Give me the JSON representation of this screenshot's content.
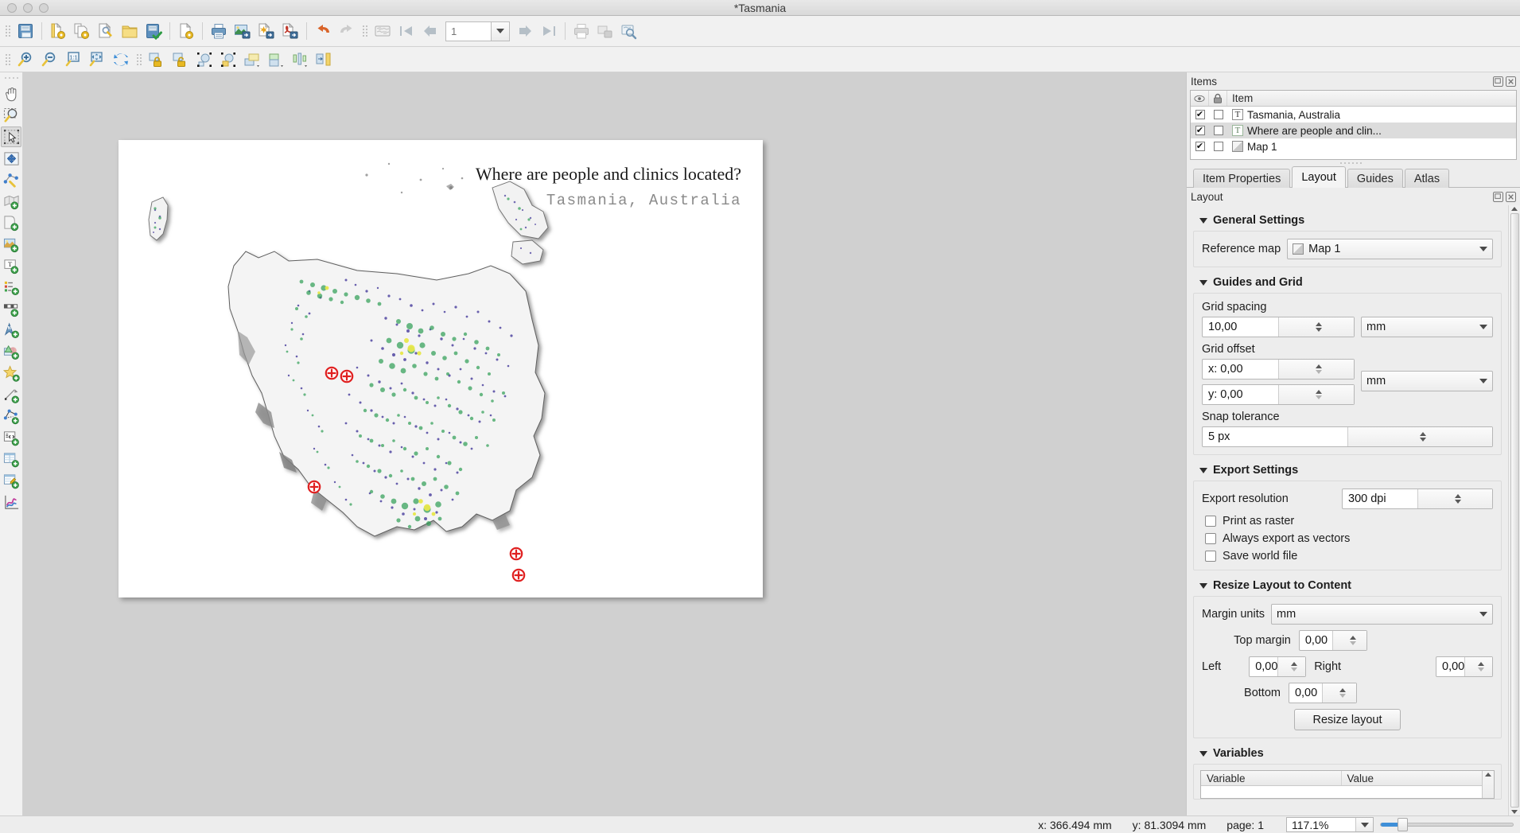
{
  "window": {
    "title": "*Tasmania"
  },
  "toolbar_main": {
    "buttons": [
      {
        "name": "save-project-icon",
        "tip": "Save Project"
      },
      {
        "name": "new-layout-icon",
        "tip": "New Layout"
      },
      {
        "name": "duplicate-layout-icon",
        "tip": "Duplicate Layout"
      },
      {
        "name": "layout-manager-icon",
        "tip": "Layout Manager"
      },
      {
        "name": "open-layout-folder-icon",
        "tip": "Layouts"
      },
      {
        "name": "save-as-template-icon",
        "tip": "Save as Template"
      },
      {
        "name": "add-pages-icon",
        "tip": "Add Pages"
      },
      {
        "name": "print-icon",
        "tip": "Print Layout"
      },
      {
        "name": "export-image-icon",
        "tip": "Export as Image"
      },
      {
        "name": "export-svg-icon",
        "tip": "Export as SVG"
      },
      {
        "name": "export-pdf-icon",
        "tip": "Export as PDF"
      },
      {
        "name": "undo-icon",
        "tip": "Undo"
      },
      {
        "name": "redo-icon",
        "tip": "Redo"
      },
      {
        "name": "revert-atlas-icon",
        "tip": "Preview Atlas"
      },
      {
        "name": "first-page-icon",
        "tip": "First Feature"
      },
      {
        "name": "previous-page-icon",
        "tip": "Previous Feature"
      },
      {
        "name": "next-page-icon",
        "tip": "Next Feature"
      },
      {
        "name": "last-page-icon",
        "tip": "Last Feature"
      },
      {
        "name": "print-atlas-icon",
        "tip": "Print Atlas"
      },
      {
        "name": "export-atlas-images-icon",
        "tip": "Export Atlas as Images"
      },
      {
        "name": "atlas-settings-icon",
        "tip": "Atlas Settings"
      }
    ],
    "page_value": "1",
    "page_placeholder": "1"
  },
  "toolbar_nav": {
    "buttons": [
      {
        "name": "zoom-in-icon",
        "tip": "Zoom In"
      },
      {
        "name": "zoom-out-icon",
        "tip": "Zoom Out"
      },
      {
        "name": "zoom-100-icon",
        "tip": "Zoom to 100%"
      },
      {
        "name": "zoom-full-icon",
        "tip": "Zoom Full"
      },
      {
        "name": "refresh-icon",
        "tip": "Refresh View"
      },
      {
        "name": "lock-items-icon",
        "tip": "Lock Selected Items"
      },
      {
        "name": "unlock-items-icon",
        "tip": "Unlock All Items"
      },
      {
        "name": "group-items-icon",
        "tip": "Group Items"
      },
      {
        "name": "ungroup-items-icon",
        "tip": "Ungroup Items"
      },
      {
        "name": "raise-items-icon",
        "tip": "Raise Selected Items"
      },
      {
        "name": "lower-items-icon",
        "tip": "Lower Selected Items"
      },
      {
        "name": "align-items-icon",
        "tip": "Align Selected Items"
      },
      {
        "name": "distribute-items-icon",
        "tip": "Distribute Items"
      }
    ]
  },
  "toolbar_tools": {
    "buttons": [
      {
        "name": "pan-layout-icon",
        "tip": "Pan Layout",
        "active": false
      },
      {
        "name": "zoom-tool-icon",
        "tip": "Zoom",
        "active": false
      },
      {
        "name": "select-move-item-icon",
        "tip": "Select/Move Item",
        "active": true
      },
      {
        "name": "move-item-content-icon",
        "tip": "Move Item Content",
        "active": false
      },
      {
        "name": "edit-nodes-icon",
        "tip": "Edit Nodes Item",
        "active": false
      },
      {
        "name": "add-map-icon",
        "tip": "Add Map",
        "active": false
      },
      {
        "name": "add-shape-icon",
        "tip": "Add Shape",
        "active": false
      },
      {
        "name": "add-picture-icon",
        "tip": "Add Picture",
        "active": false
      },
      {
        "name": "add-label-icon",
        "tip": "Add Label",
        "active": false
      },
      {
        "name": "add-legend-icon",
        "tip": "Add Legend",
        "active": false
      },
      {
        "name": "add-scalebar-icon",
        "tip": "Add Scale Bar",
        "active": false
      },
      {
        "name": "add-north-arrow-icon",
        "tip": "Add North Arrow",
        "active": false
      },
      {
        "name": "add-marker-icon",
        "tip": "Add Marker",
        "active": false
      },
      {
        "name": "add-node-shape-icon",
        "tip": "Add Node Item",
        "active": false
      },
      {
        "name": "add-arrow-icon",
        "tip": "Add Arrow",
        "active": false
      },
      {
        "name": "add-polyline-icon",
        "tip": "Add Polyline",
        "active": false
      },
      {
        "name": "add-html-icon",
        "tip": "Add HTML Frame",
        "active": false
      },
      {
        "name": "add-attribute-table-icon",
        "tip": "Add Attribute Table",
        "active": false
      },
      {
        "name": "add-fixed-table-icon",
        "tip": "Add Fixed Table",
        "active": false
      },
      {
        "name": "add-plot-icon",
        "tip": "Add Plot",
        "active": false
      }
    ]
  },
  "layout_page": {
    "title_main": "Where are people and clinics located?",
    "title_sub": "Tasmania, Australia"
  },
  "items_panel": {
    "header": "Items",
    "columns": {
      "visible": "eye-icon",
      "lock": "lock-icon",
      "item": "Item"
    },
    "rows": [
      {
        "label": "Tasmania, Australia",
        "visible": true,
        "locked": false,
        "type": "label",
        "selected": false
      },
      {
        "label": "Where are people and clin...",
        "visible": true,
        "locked": false,
        "type": "label",
        "selected": true
      },
      {
        "label": "Map 1",
        "visible": true,
        "locked": false,
        "type": "map",
        "selected": false
      }
    ]
  },
  "tabs": [
    {
      "label": "Item Properties",
      "selected": false
    },
    {
      "label": "Layout",
      "selected": true
    },
    {
      "label": "Guides",
      "selected": false
    },
    {
      "label": "Atlas",
      "selected": false
    }
  ],
  "layout_panel": {
    "header": "Layout",
    "general_settings": {
      "title": "General Settings",
      "reference_map_label": "Reference map",
      "reference_map_value": "Map 1"
    },
    "guides_and_grid": {
      "title": "Guides and Grid",
      "grid_spacing_label": "Grid spacing",
      "grid_spacing_value": "10,00",
      "grid_spacing_units": "mm",
      "grid_offset_label": "Grid offset",
      "grid_offset_x": "x: 0,00",
      "grid_offset_y": "y: 0,00",
      "grid_offset_units": "mm",
      "snap_tolerance_label": "Snap tolerance",
      "snap_tolerance_value": "5 px"
    },
    "export_settings": {
      "title": "Export Settings",
      "export_resolution_label": "Export resolution",
      "export_resolution_value": "300 dpi",
      "print_as_raster": {
        "label": "Print as raster",
        "checked": false
      },
      "always_export_as_vectors": {
        "label": "Always export as vectors",
        "checked": false
      },
      "save_world_file": {
        "label": "Save world file",
        "checked": false
      }
    },
    "resize_layout": {
      "title": "Resize Layout to Content",
      "margin_units_label": "Margin units",
      "margin_units_value": "mm",
      "top_margin_label": "Top margin",
      "top_margin_value": "0,00",
      "left_label": "Left",
      "left_value": "0,00",
      "right_label": "Right",
      "right_value": "0,00",
      "bottom_label": "Bottom",
      "bottom_value": "0,00",
      "resize_button": "Resize layout"
    },
    "variables": {
      "title": "Variables",
      "col_variable": "Variable",
      "col_value": "Value"
    }
  },
  "statusbar": {
    "x": "x: 366.494 mm",
    "y": "y: 81.3094 mm",
    "page": "page: 1",
    "zoom": "117.1%"
  },
  "colors": {
    "accent_blue": "#3f8fd8",
    "panel_bg": "#ededed",
    "canvas_bg": "#d0d0d0",
    "marker_red": "#e02020",
    "vegetation_green": "#2e9e54",
    "population_purple": "#4a3f9e",
    "highlight_yellow": "#e8e84a"
  }
}
